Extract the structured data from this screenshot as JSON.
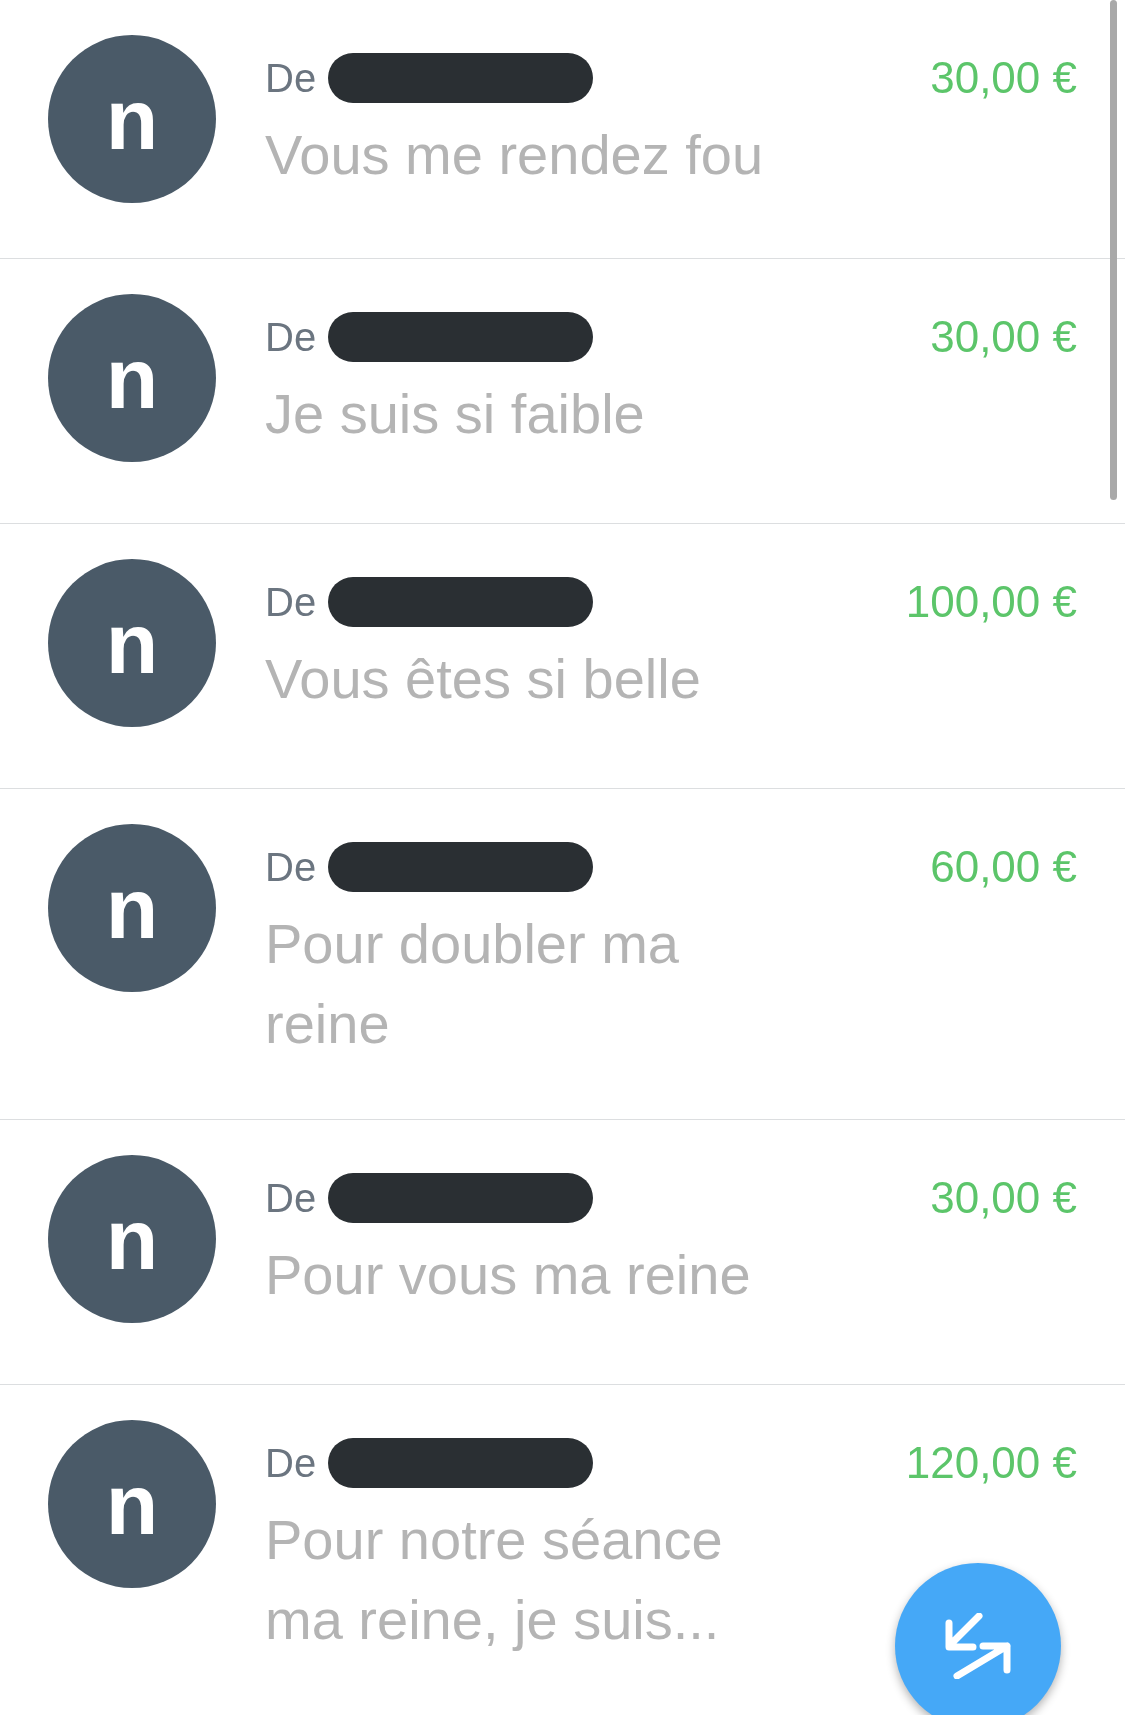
{
  "transactions": [
    {
      "avatar": "n",
      "from_label": "De",
      "sender_redacted": true,
      "amount": "30,00 €",
      "message": "Vous me rendez fou"
    },
    {
      "avatar": "n",
      "from_label": "De",
      "sender_redacted": true,
      "amount": "30,00 €",
      "message": "Je suis si faible"
    },
    {
      "avatar": "n",
      "from_label": "De",
      "sender_redacted": true,
      "amount": "100,00 €",
      "message": "Vous êtes si belle"
    },
    {
      "avatar": "n",
      "from_label": "De",
      "sender_redacted": true,
      "amount": "60,00 €",
      "message": "Pour doubler ma reine"
    },
    {
      "avatar": "n",
      "from_label": "De",
      "sender_redacted": true,
      "amount": "30,00 €",
      "message": "Pour vous ma reine"
    },
    {
      "avatar": "n",
      "from_label": "De",
      "sender_redacted": true,
      "amount": "120,00 €",
      "message": "Pour notre séance ma reine, je suis..."
    }
  ]
}
